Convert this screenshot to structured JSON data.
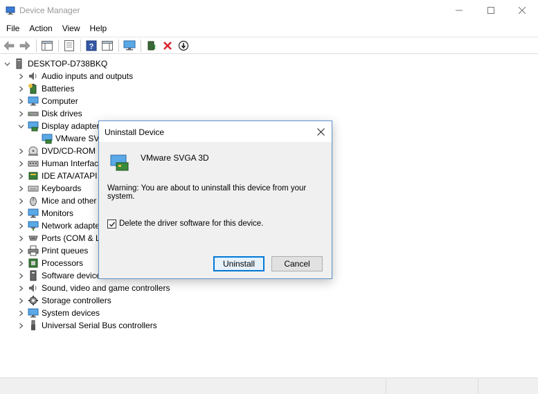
{
  "window": {
    "title": "Device Manager",
    "controls": {
      "minimize": "—",
      "maximize": "☐",
      "close": "✕"
    }
  },
  "menu": [
    "File",
    "Action",
    "View",
    "Help"
  ],
  "toolbar": {
    "icons": [
      "back-arrow-icon",
      "forward-arrow-icon",
      "show-hide-console-tree-icon",
      "properties-icon",
      "help-icon",
      "action-pane-icon",
      "monitor-icon",
      "update-driver-icon",
      "uninstall-device-icon",
      "scan-hardware-icon"
    ]
  },
  "tree": {
    "root": "DESKTOP-D738BKQ",
    "items": [
      {
        "label": "Audio inputs and outputs",
        "expanded": false
      },
      {
        "label": "Batteries",
        "expanded": false
      },
      {
        "label": "Computer",
        "expanded": false
      },
      {
        "label": "Disk drives",
        "expanded": false
      },
      {
        "label": "Display adapters",
        "expanded": true
      },
      {
        "label": "VMware SVGA 3D",
        "child": true
      },
      {
        "label": "DVD/CD-ROM drives",
        "expanded": false
      },
      {
        "label": "Human Interface Devices",
        "expanded": false
      },
      {
        "label": "IDE ATA/ATAPI controllers",
        "expanded": false
      },
      {
        "label": "Keyboards",
        "expanded": false
      },
      {
        "label": "Mice and other pointing devices",
        "expanded": false
      },
      {
        "label": "Monitors",
        "expanded": false
      },
      {
        "label": "Network adapters",
        "expanded": false
      },
      {
        "label": "Ports (COM & LPT)",
        "expanded": false
      },
      {
        "label": "Print queues",
        "expanded": false
      },
      {
        "label": "Processors",
        "expanded": false
      },
      {
        "label": "Software devices",
        "expanded": false
      },
      {
        "label": "Sound, video and game controllers",
        "expanded": false
      },
      {
        "label": "Storage controllers",
        "expanded": false
      },
      {
        "label": "System devices",
        "expanded": false
      },
      {
        "label": "Universal Serial Bus controllers",
        "expanded": false
      }
    ]
  },
  "dialog": {
    "title": "Uninstall Device",
    "device_name": "VMware SVGA 3D",
    "warning": "Warning: You are about to uninstall this device from your system.",
    "checkbox_label": "Delete the driver software for this device.",
    "checkbox_checked": true,
    "uninstall_label": "Uninstall",
    "cancel_label": "Cancel",
    "close_glyph": "✕"
  },
  "colors": {
    "accent": "#0078d7",
    "dialog_border": "#5b8fc7",
    "dialog_bg": "#f0f0f0",
    "uninstall_red": "#d9232e",
    "update_green": "#2e8b3a"
  }
}
